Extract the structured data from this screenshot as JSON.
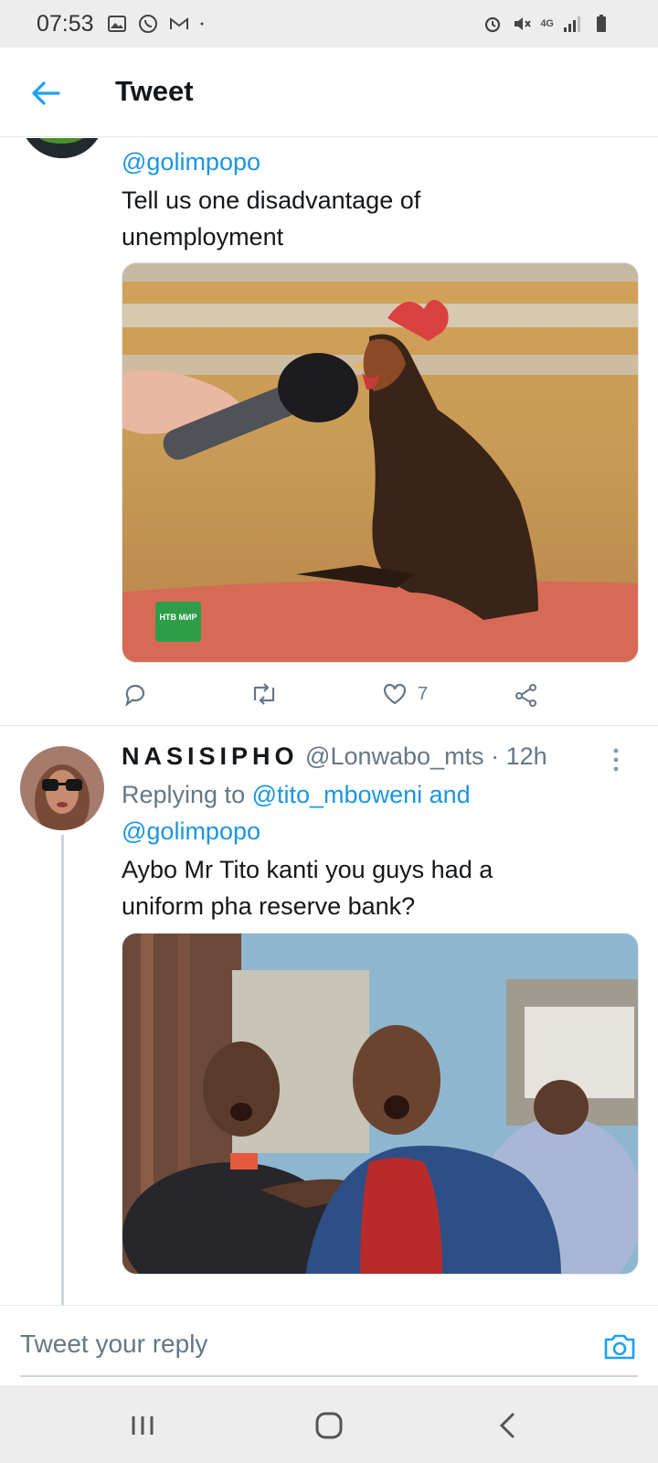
{
  "status_bar": {
    "time": "07:53",
    "left_icons": [
      "gallery-icon",
      "whatsapp-icon",
      "gmail-icon",
      "dot-icon"
    ],
    "right_icons": [
      "alarm-icon",
      "mute-icon",
      "4g-icon",
      "signal-icon",
      "battery-icon"
    ],
    "network": "4G"
  },
  "header": {
    "title": "Tweet",
    "back_icon": "arrow-left-icon"
  },
  "tweets": [
    {
      "replying_to": "@golimpopo",
      "text": "Tell us one disadvantage of unemployment",
      "text_line1": "Tell us one disadvantage of",
      "text_line2": "unemployment",
      "media_description": "rooster interviewed with microphone",
      "media_watermark": "НТВ МИР",
      "actions": {
        "reply_icon": "reply-icon",
        "retweet_icon": "retweet-icon",
        "like_icon": "heart-icon",
        "like_count": "7",
        "share_icon": "share-icon"
      }
    },
    {
      "display_name": "NASISIPHO",
      "handle": "@Lonwabo_mts",
      "separator": "·",
      "time": "12h",
      "replying_prefix": "Replying to",
      "replying_to_1": "@tito_mboweni and",
      "replying_to_2": "@golimpopo",
      "text_line1": "Aybo Mr Tito kanti you guys had a",
      "text_line2": "uniform pha reserve bank?",
      "media_description": "two men singing outdoors"
    }
  ],
  "reply_bar": {
    "placeholder": "Tweet your reply",
    "camera_icon": "camera-icon"
  },
  "nav_bar": {
    "recents_icon": "recents-icon",
    "home_icon": "home-icon",
    "back_icon": "back-icon"
  },
  "colors": {
    "accent": "#1da1f2",
    "link": "#1b95e0",
    "muted": "#657786"
  }
}
